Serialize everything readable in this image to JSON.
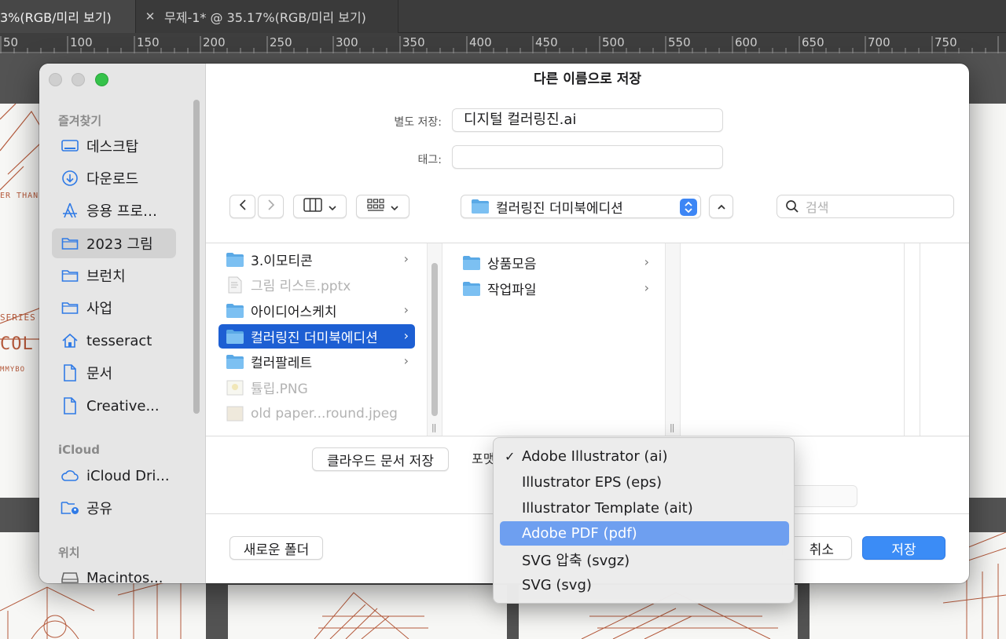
{
  "app": {
    "tabs": [
      {
        "label": "3%(RGB/미리 보기)",
        "active": true
      },
      {
        "label": "무제-1* @ 35.17%(RGB/미리 보기)",
        "active": false
      }
    ],
    "ruler_labels": [
      "50",
      "100",
      "150",
      "200",
      "250",
      "300",
      "350",
      "400",
      "450",
      "500",
      "550",
      "600",
      "650",
      "700",
      "750"
    ],
    "artwork_text": [
      "ER THAN",
      "SERIES",
      "COL",
      "MMYBO"
    ],
    "accent_color": "#b55a3c"
  },
  "dialog": {
    "title": "다른 이름으로 저장",
    "save_as_label": "별도 저장:",
    "save_as_value": "디지털 컬러링진.ai",
    "tags_label": "태그:",
    "tags_value": "",
    "location": "컬러링진 더미북에디션",
    "search_placeholder": "검색",
    "sidebar": {
      "favorites_title": "즐겨찾기",
      "favorites": [
        {
          "label": "데스크탑",
          "icon": "desktop-icon"
        },
        {
          "label": "다운로드",
          "icon": "download-icon"
        },
        {
          "label": "응용 프로…",
          "icon": "applications-icon"
        },
        {
          "label": "2023 그림",
          "icon": "folder-icon",
          "selected": true
        },
        {
          "label": "브런치",
          "icon": "folder-icon"
        },
        {
          "label": "사업",
          "icon": "folder-icon"
        },
        {
          "label": "tesseract",
          "icon": "home-icon"
        },
        {
          "label": "문서",
          "icon": "document-icon"
        },
        {
          "label": "Creative...",
          "icon": "file-icon"
        }
      ],
      "icloud_title": "iCloud",
      "icloud": [
        {
          "label": "iCloud Dri...",
          "icon": "cloud-icon"
        },
        {
          "label": "공유",
          "icon": "shared-folder-icon"
        }
      ],
      "locations_title": "위치",
      "locations": [
        {
          "label": "Macintos...",
          "icon": "disk-icon"
        }
      ]
    },
    "column1": [
      {
        "label": "3.이모티콘",
        "kind": "folder",
        "chevron": true
      },
      {
        "label": "그림 리스트.pptx",
        "kind": "file",
        "dim": true
      },
      {
        "label": "아이디어스케치",
        "kind": "folder",
        "chevron": true
      },
      {
        "label": "컬러링진 더미북에디션",
        "kind": "folder",
        "chevron": true,
        "selected": true
      },
      {
        "label": "컬러팔레트",
        "kind": "folder",
        "chevron": true
      },
      {
        "label": "튤립.PNG",
        "kind": "image",
        "dim": true
      },
      {
        "label": "old paper...round.jpeg",
        "kind": "image",
        "dim": true
      }
    ],
    "column2": [
      {
        "label": "상품모음",
        "kind": "folder",
        "chevron": true
      },
      {
        "label": "작업파일",
        "kind": "folder",
        "chevron": true
      }
    ],
    "cloud_save_label": "클라우드 문서 저장",
    "format_label": "포맷",
    "new_folder_label": "새로운 폴더",
    "cancel_label": "취소",
    "save_label": "저장"
  },
  "format_menu": {
    "items": [
      {
        "label": "Adobe Illustrator (ai)",
        "checked": true
      },
      {
        "label": "Illustrator EPS (eps)"
      },
      {
        "label": "Illustrator Template (ait)"
      },
      {
        "label": "Adobe PDF (pdf)",
        "highlighted": true
      },
      {
        "label": "SVG 압축 (svgz)"
      },
      {
        "label": "SVG (svg)"
      }
    ],
    "check_mark": "✓"
  },
  "colors": {
    "primary_button": "#3b8cf6",
    "selection": "#1d5fd3",
    "menu_highlight": "#6e9ff0",
    "folder": "#5aa9e6"
  }
}
